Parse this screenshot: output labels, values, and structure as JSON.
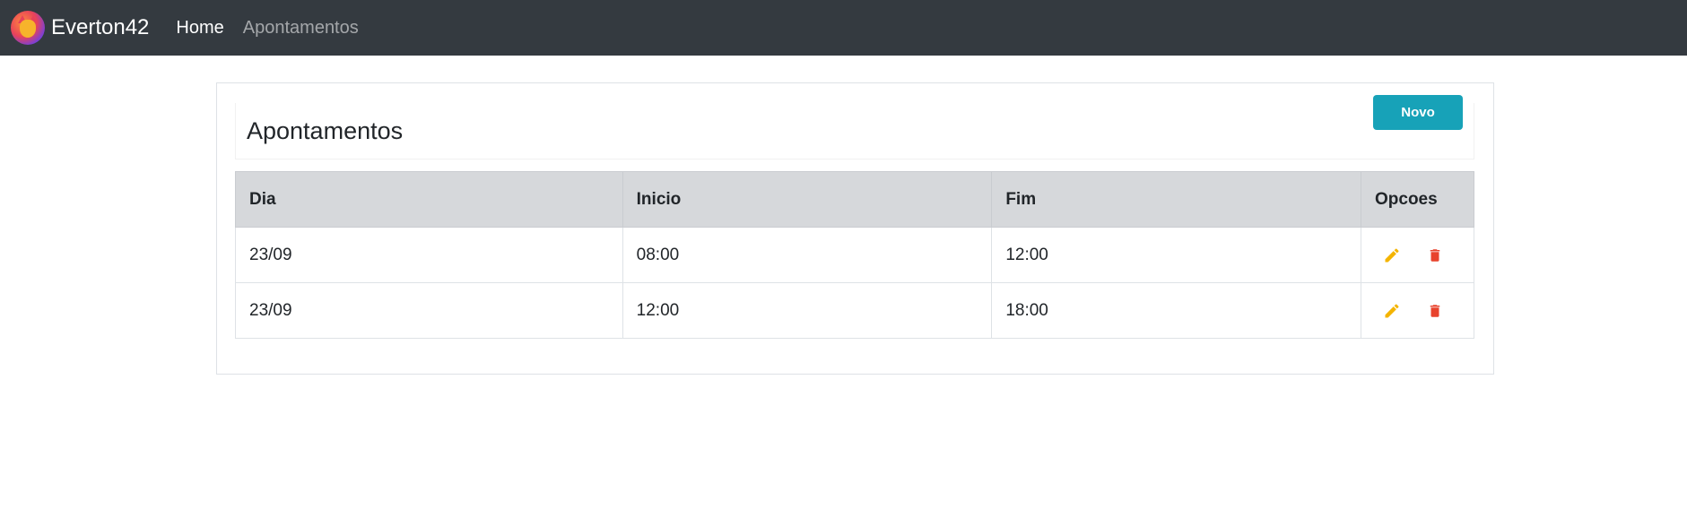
{
  "navbar": {
    "brand": "Everton42",
    "links": [
      {
        "label": "Home",
        "active": true
      },
      {
        "label": "Apontamentos",
        "active": false
      }
    ]
  },
  "card": {
    "title": "Apontamentos",
    "new_button": "Novo"
  },
  "table": {
    "headers": [
      "Dia",
      "Inicio",
      "Fim",
      "Opcoes"
    ],
    "rows": [
      {
        "dia": "23/09",
        "inicio": "08:00",
        "fim": "12:00"
      },
      {
        "dia": "23/09",
        "inicio": "12:00",
        "fim": "18:00"
      }
    ]
  },
  "colors": {
    "navbar_bg": "#343a40",
    "button_bg": "#17a2b8",
    "edit_icon": "#f4b400",
    "delete_icon": "#e8432d",
    "header_row_bg": "#d6d8db"
  },
  "icons": {
    "edit": "pencil-icon",
    "delete": "trash-icon"
  }
}
